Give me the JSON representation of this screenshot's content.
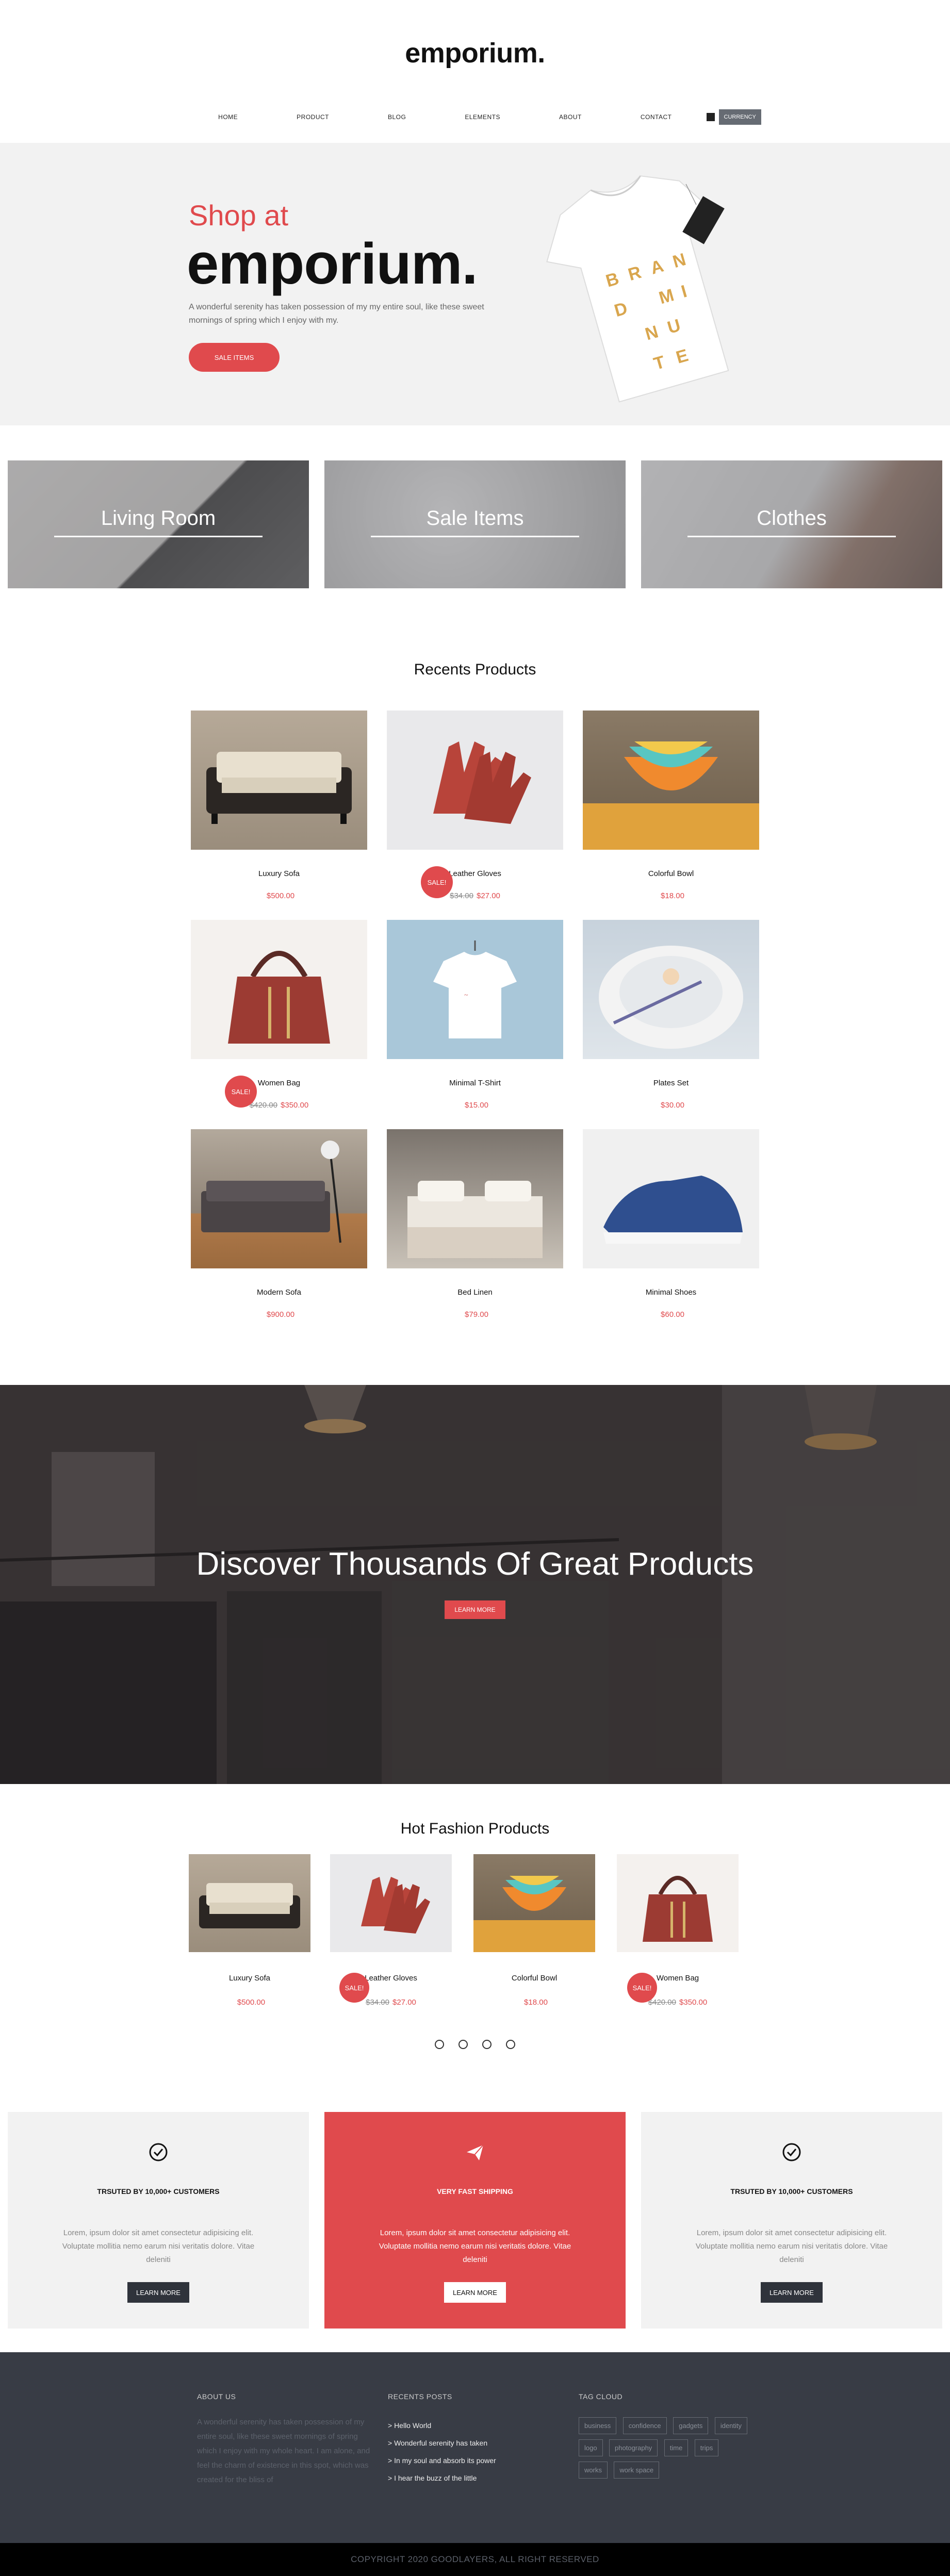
{
  "header": {
    "logo": "emporium.",
    "nav": [
      "HOME",
      "PRODUCT",
      "BLOG",
      "ELEMENTS",
      "ABOUT",
      "CONTACT"
    ],
    "currency_button": "CURRENCY"
  },
  "hero": {
    "subtitle": "Shop at",
    "title": "emporium.",
    "text": "A wonderful serenity has taken possession of my my entire soul, like these sweet mornings of spring which I enjoy with my.",
    "button": "SALE ITEMS",
    "tshirt_print": [
      "B",
      "R",
      "A",
      "N",
      "D",
      "M",
      "I",
      "N",
      "U",
      "T",
      "E"
    ]
  },
  "categories": [
    "Living Room",
    "Sale Items",
    "Clothes"
  ],
  "recent": {
    "title": "Recents Products",
    "products": [
      {
        "name": "Luxury Sofa",
        "old": "",
        "price": "$500.00",
        "sale": ""
      },
      {
        "name": "Leather Gloves",
        "old": "$34.00",
        "price": "$27.00",
        "sale": "SALE!"
      },
      {
        "name": "Colorful Bowl",
        "old": "",
        "price": "$18.00",
        "sale": ""
      },
      {
        "name": "Women Bag",
        "old": "$420.00",
        "price": "$350.00",
        "sale": "SALE!"
      },
      {
        "name": "Minimal T-Shirt",
        "old": "",
        "price": "$15.00",
        "sale": ""
      },
      {
        "name": "Plates Set",
        "old": "",
        "price": "$30.00",
        "sale": ""
      },
      {
        "name": "Modern Sofa",
        "old": "",
        "price": "$900.00",
        "sale": ""
      },
      {
        "name": "Bed Linen",
        "old": "",
        "price": "$79.00",
        "sale": ""
      },
      {
        "name": "Minimal Shoes",
        "old": "",
        "price": "$60.00",
        "sale": ""
      }
    ]
  },
  "banner": {
    "title": "Discover Thousands Of Great Products",
    "button": "LEARN MORE"
  },
  "hot": {
    "title": "Hot Fashion Products",
    "products": [
      {
        "name": "Luxury Sofa",
        "old": "",
        "price": "$500.00",
        "sale": ""
      },
      {
        "name": "Leather Gloves",
        "old": "$34.00",
        "price": "$27.00",
        "sale": "SALE!"
      },
      {
        "name": "Colorful Bowl",
        "old": "",
        "price": "$18.00",
        "sale": ""
      },
      {
        "name": "Women Bag",
        "old": "$420.00",
        "price": "$350.00",
        "sale": "SALE!"
      }
    ]
  },
  "features": [
    {
      "title": "TRSUTED BY 10,000+ CUSTOMERS",
      "text": "Lorem, ipsum dolor sit amet consectetur adipisicing elit. Voluptate mollitia nemo earum nisi veritatis dolore. Vitae deleniti",
      "button": "LEARN MORE",
      "icon": "check-circle-icon"
    },
    {
      "title": "VERY FAST SHIPPING",
      "text": "Lorem, ipsum dolor sit amet consectetur adipisicing elit. Voluptate mollitia nemo earum nisi veritatis dolore. Vitae deleniti",
      "button": "LEARN MORE",
      "icon": "paper-plane-icon"
    },
    {
      "title": "TRSUTED BY 10,000+ CUSTOMERS",
      "text": "Lorem, ipsum dolor sit amet consectetur adipisicing elit. Voluptate mollitia nemo earum nisi veritatis dolore. Vitae deleniti",
      "button": "LEARN MORE",
      "icon": "check-circle-icon"
    }
  ],
  "footer": {
    "about_title": "ABOUT US",
    "about_text": "A wonderful serenity has taken possession of my entire soul, like these sweet mornings of spring which I enjoy with my whole heart. I am alone, and feel the charm of existence in this spot, which was created for the bliss of",
    "posts_title": "RECENTS POSTS",
    "posts": [
      "> Hello World",
      "> Wonderful serenity has taken",
      "> In my soul and absorb its power",
      "> I hear the buzz of the little"
    ],
    "tags_title": "TAG CLOUD",
    "tags": [
      "business",
      "confidence",
      "gadgets",
      "identity",
      "logo",
      "photography",
      "time",
      "trips",
      "works",
      "work space"
    ],
    "copyright": "COPYRIGHT 2020 GOODLAYERS, ALL RIGHT RESERVED"
  },
  "colors": {
    "accent": "#e04a4d",
    "dark": "#383c45",
    "light_bg": "#f2f2f2"
  }
}
